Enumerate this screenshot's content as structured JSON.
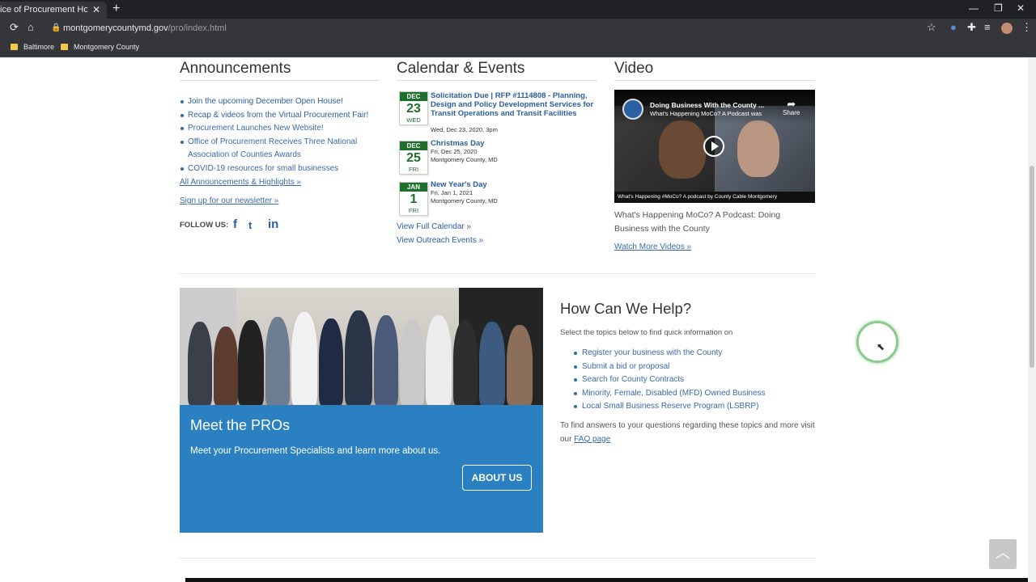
{
  "browser": {
    "tab_title": "ice of Procurement Homepag",
    "tab_close": "✕",
    "new_tab": "+",
    "window_controls": {
      "minimize": "—",
      "restore": "❐",
      "close": "✕"
    },
    "url_host": "montgomerycountymd.gov",
    "url_path": "/pro/index.html",
    "bookmarks": [
      "Baltimore",
      "Montgomery County"
    ],
    "icons": [
      "back-icon",
      "reload-icon",
      "home-icon",
      "lock-icon",
      "star-icon",
      "extensions-icon",
      "reading-list-icon",
      "profile-avatar",
      "menu-icon"
    ]
  },
  "announcements": {
    "heading": "Announcements",
    "items": [
      "Join the upcoming December Open House!",
      "Recap & videos from the Virtual Procurement Fair!",
      "Procurement Launches New Website!",
      "Office of Procurement Receives Three National",
      "Association of Counties Awards",
      "COVID-19 resources for small businesses"
    ],
    "all_link": "All Announcements & Highlights »",
    "newsletter_link": "Sign up for our newsletter »",
    "follow_label": "FOLLOW US:",
    "social": {
      "facebook": "f",
      "twitter": "t",
      "linkedin": "in"
    }
  },
  "calendar": {
    "heading": "Calendar & Events",
    "events": [
      {
        "month": "DEC",
        "day": "23",
        "weekday": "WED",
        "title": "Solicitation Due | RFP #1114808 - Planning, Design and Policy Development Services for Transit Operations and Transit Facilities",
        "meta1": "Wed, Dec 23, 2020, 3pm",
        "meta2": ""
      },
      {
        "month": "DEC",
        "day": "25",
        "weekday": "FRI",
        "title": "Christmas Day",
        "meta1": "Fri, Dec 25, 2020",
        "meta2": "Montgomery County, MD"
      },
      {
        "month": "JAN",
        "day": "1",
        "weekday": "FRI",
        "title": "New Year's Day",
        "meta1": "Fri, Jan 1, 2021",
        "meta2": "Montgomery County, MD"
      }
    ],
    "full_calendar": "View Full Calendar »",
    "outreach": "View Outreach Events »"
  },
  "video": {
    "heading": "Video",
    "player_title": "Doing Business With the County ...",
    "player_subtitle": "What's Happening MoCo? A Podcast was",
    "share_label": "Share",
    "bottom_text": "What's Happening #MoCo?     A podcast by County Cable Montgomery",
    "caption": "What's Happening MoCo? A Podcast: Doing Business with the County",
    "more_link": "Watch More Videos »"
  },
  "meet": {
    "heading": "Meet the PROs",
    "text": "Meet your Procurement Specialists and learn more about us.",
    "button": "ABOUT US"
  },
  "help": {
    "heading": "How Can We Help?",
    "intro": "Select the topics below to find quick information on",
    "items": [
      "Register your business with the County",
      "Submit a bid or proposal",
      "Search for County Contracts",
      "Minority, Female, Disabled (MFD) Owned Business",
      "Local Small Business Reserve Program (LSBRP)"
    ],
    "more_text": "To find answers to your questions regarding these topics and more visit our",
    "faq_link": "FAQ page"
  },
  "colors": {
    "link": "#3a6aa8",
    "calendar_green": "#1f6f2c",
    "meet_blue": "#2a80c0",
    "chrome_dark": "#35363a"
  }
}
